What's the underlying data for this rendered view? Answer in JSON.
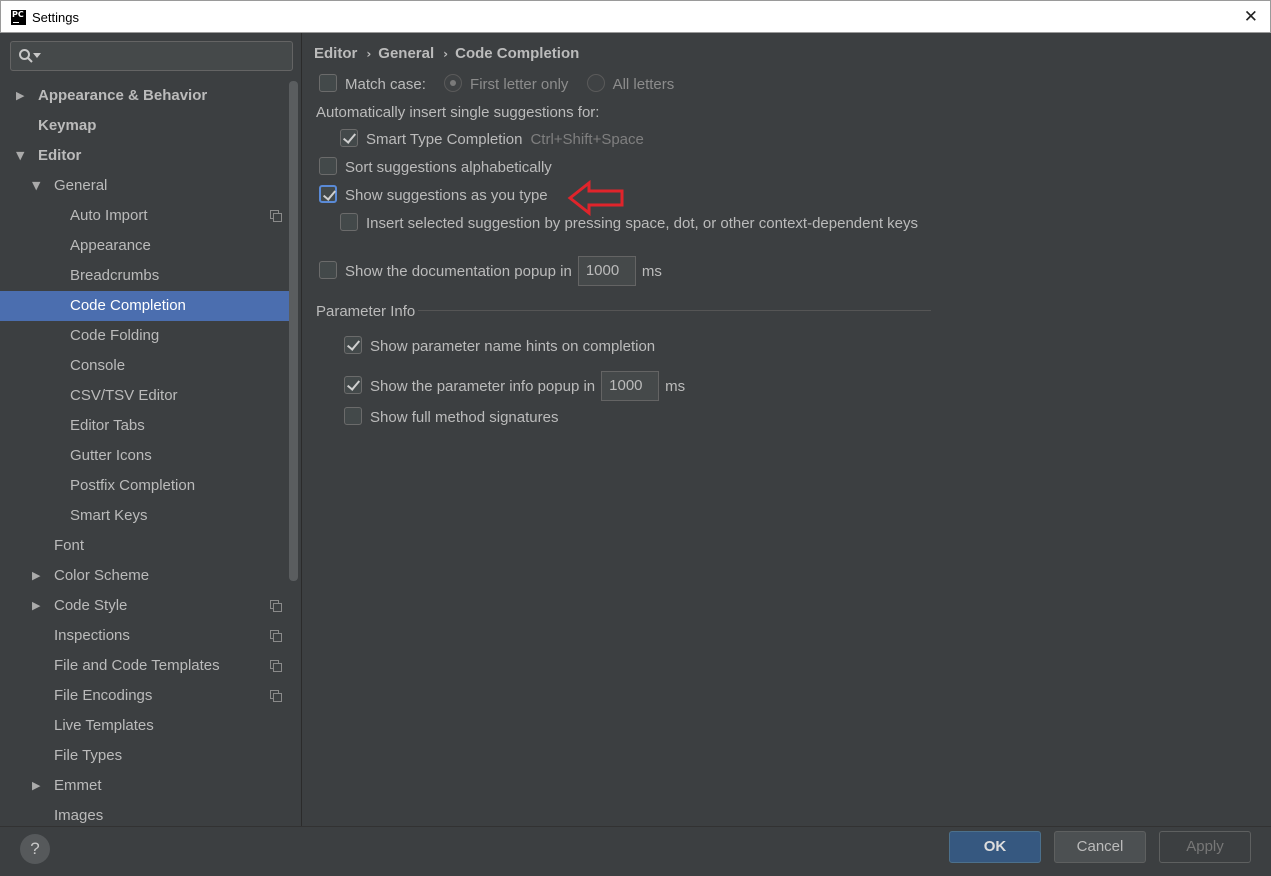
{
  "window": {
    "title": "Settings",
    "app_icon_text": "PC",
    "close_symbol": "✕"
  },
  "search": {
    "placeholder": "",
    "icon": "search-icon"
  },
  "sidebar": {
    "items": [
      {
        "label": "Appearance & Behavior",
        "level": 0,
        "arrow": "▶",
        "bold": true
      },
      {
        "label": "Keymap",
        "level": 0,
        "arrow": "",
        "bold": true
      },
      {
        "label": "Editor",
        "level": 0,
        "arrow": "▼",
        "bold": true
      },
      {
        "label": "General",
        "level": 1,
        "arrow": "▼"
      },
      {
        "label": "Auto Import",
        "level": 2,
        "badge": true
      },
      {
        "label": "Appearance",
        "level": 2
      },
      {
        "label": "Breadcrumbs",
        "level": 2
      },
      {
        "label": "Code Completion",
        "level": 2,
        "selected": true
      },
      {
        "label": "Code Folding",
        "level": 2
      },
      {
        "label": "Console",
        "level": 2
      },
      {
        "label": "CSV/TSV Editor",
        "level": 2
      },
      {
        "label": "Editor Tabs",
        "level": 2
      },
      {
        "label": "Gutter Icons",
        "level": 2
      },
      {
        "label": "Postfix Completion",
        "level": 2
      },
      {
        "label": "Smart Keys",
        "level": 2
      },
      {
        "label": "Font",
        "level": 1
      },
      {
        "label": "Color Scheme",
        "level": 1,
        "arrow": "▶"
      },
      {
        "label": "Code Style",
        "level": 1,
        "arrow": "▶",
        "badge": true
      },
      {
        "label": "Inspections",
        "level": 1,
        "badge": true
      },
      {
        "label": "File and Code Templates",
        "level": 1,
        "badge": true
      },
      {
        "label": "File Encodings",
        "level": 1,
        "badge": true
      },
      {
        "label": "Live Templates",
        "level": 1
      },
      {
        "label": "File Types",
        "level": 1
      },
      {
        "label": "Emmet",
        "level": 1,
        "arrow": "▶"
      },
      {
        "label": "Images",
        "level": 1
      }
    ]
  },
  "breadcrumb": {
    "items": [
      "Editor",
      "General",
      "Code Completion"
    ],
    "separator": "›"
  },
  "settings": {
    "match_case": {
      "label": "Match case:",
      "checked": false
    },
    "radio_first_letter": {
      "label": "First letter only",
      "selected": true
    },
    "radio_all_letters": {
      "label": "All letters",
      "selected": false
    },
    "auto_insert_heading": "Automatically insert single suggestions for:",
    "smart_type": {
      "label": "Smart Type Completion",
      "shortcut": "Ctrl+Shift+Space",
      "checked": true
    },
    "sort_alpha": {
      "label": "Sort suggestions alphabetically",
      "checked": false
    },
    "show_as_type": {
      "label": "Show suggestions as you type",
      "checked": true
    },
    "insert_selected": {
      "label": "Insert selected suggestion by pressing space, dot, or other context-dependent keys",
      "checked": false
    },
    "doc_popup": {
      "label": "Show the documentation popup in",
      "value": "1000",
      "unit": "ms",
      "checked": false
    }
  },
  "parameter_info": {
    "title": "Parameter Info",
    "name_hints": {
      "label": "Show parameter name hints on completion",
      "checked": true
    },
    "info_popup": {
      "label": "Show the parameter info popup in",
      "value": "1000",
      "unit": "ms",
      "checked": true
    },
    "full_signatures": {
      "label": "Show full method signatures",
      "checked": false
    }
  },
  "footer": {
    "help": "?",
    "ok": "OK",
    "cancel": "Cancel",
    "apply": "Apply"
  },
  "colors": {
    "selection": "#4b6eaf",
    "background": "#3c3f41",
    "annotation_arrow": "#e0242b",
    "ok_button": "#365880"
  }
}
